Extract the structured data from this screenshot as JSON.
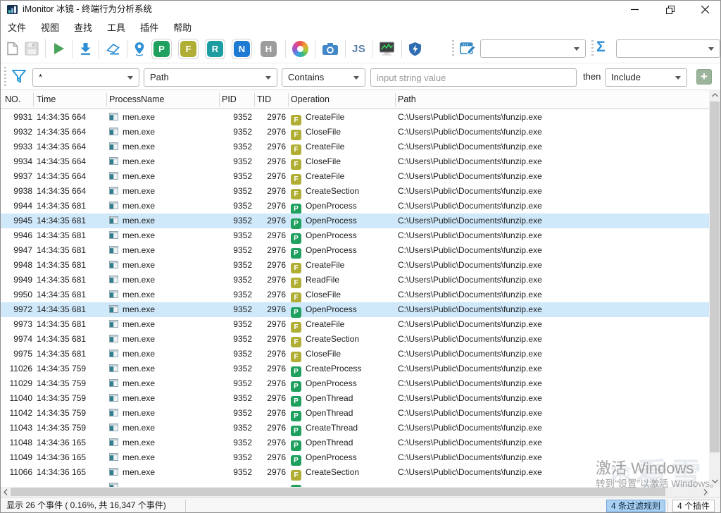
{
  "window": {
    "title": "iMonitor 冰镜 - 终端行为分析系统"
  },
  "menu": {
    "items": [
      "文件",
      "视图",
      "查找",
      "工具",
      "插件",
      "帮助"
    ]
  },
  "toolbar": {
    "letter_buttons": [
      {
        "label": "P",
        "color": "#1fa05e",
        "active": true
      },
      {
        "label": "F",
        "color": "#b0ae35",
        "active": true
      },
      {
        "label": "R",
        "color": "#1d9da2",
        "active": true
      },
      {
        "label": "N",
        "color": "#1d79d2",
        "active": true
      },
      {
        "label": "H",
        "color": "#9c9c9c",
        "active": false
      }
    ],
    "js_label": "JS",
    "sigma_label": "Σ",
    "combo1_value": "",
    "combo2_value": ""
  },
  "filter_bar": {
    "scope_value": "*",
    "field_value": "Path",
    "operator_value": "Contains",
    "input_value": "",
    "input_placeholder": "input string value",
    "then_label": "then",
    "action_value": "Include",
    "add_label": "+"
  },
  "table": {
    "columns": [
      "NO.",
      "Time",
      "ProcessName",
      "PID",
      "TID",
      "Operation",
      "Path"
    ],
    "rows": [
      {
        "no": "9931",
        "time": "14:34:35 664",
        "process": "men.exe",
        "pid": "9352",
        "tid": "2976",
        "op_icon": "F",
        "op": "CreateFile",
        "path": "C:\\Users\\Public\\Documents\\funzip.exe",
        "selected": false
      },
      {
        "no": "9932",
        "time": "14:34:35 664",
        "process": "men.exe",
        "pid": "9352",
        "tid": "2976",
        "op_icon": "F",
        "op": "CloseFile",
        "path": "C:\\Users\\Public\\Documents\\funzip.exe",
        "selected": false
      },
      {
        "no": "9933",
        "time": "14:34:35 664",
        "process": "men.exe",
        "pid": "9352",
        "tid": "2976",
        "op_icon": "F",
        "op": "CreateFile",
        "path": "C:\\Users\\Public\\Documents\\funzip.exe",
        "selected": false
      },
      {
        "no": "9934",
        "time": "14:34:35 664",
        "process": "men.exe",
        "pid": "9352",
        "tid": "2976",
        "op_icon": "F",
        "op": "CloseFile",
        "path": "C:\\Users\\Public\\Documents\\funzip.exe",
        "selected": false
      },
      {
        "no": "9937",
        "time": "14:34:35 664",
        "process": "men.exe",
        "pid": "9352",
        "tid": "2976",
        "op_icon": "F",
        "op": "CreateFile",
        "path": "C:\\Users\\Public\\Documents\\funzip.exe",
        "selected": false
      },
      {
        "no": "9938",
        "time": "14:34:35 664",
        "process": "men.exe",
        "pid": "9352",
        "tid": "2976",
        "op_icon": "F",
        "op": "CreateSection",
        "path": "C:\\Users\\Public\\Documents\\funzip.exe",
        "selected": false
      },
      {
        "no": "9944",
        "time": "14:34:35 681",
        "process": "men.exe",
        "pid": "9352",
        "tid": "2976",
        "op_icon": "P",
        "op": "OpenProcess",
        "path": "C:\\Users\\Public\\Documents\\funzip.exe",
        "selected": false
      },
      {
        "no": "9945",
        "time": "14:34:35 681",
        "process": "men.exe",
        "pid": "9352",
        "tid": "2976",
        "op_icon": "P",
        "op": "OpenProcess",
        "path": "C:\\Users\\Public\\Documents\\funzip.exe",
        "selected": true
      },
      {
        "no": "9946",
        "time": "14:34:35 681",
        "process": "men.exe",
        "pid": "9352",
        "tid": "2976",
        "op_icon": "P",
        "op": "OpenProcess",
        "path": "C:\\Users\\Public\\Documents\\funzip.exe",
        "selected": false
      },
      {
        "no": "9947",
        "time": "14:34:35 681",
        "process": "men.exe",
        "pid": "9352",
        "tid": "2976",
        "op_icon": "P",
        "op": "OpenProcess",
        "path": "C:\\Users\\Public\\Documents\\funzip.exe",
        "selected": false
      },
      {
        "no": "9948",
        "time": "14:34:35 681",
        "process": "men.exe",
        "pid": "9352",
        "tid": "2976",
        "op_icon": "F",
        "op": "CreateFile",
        "path": "C:\\Users\\Public\\Documents\\funzip.exe",
        "selected": false
      },
      {
        "no": "9949",
        "time": "14:34:35 681",
        "process": "men.exe",
        "pid": "9352",
        "tid": "2976",
        "op_icon": "F",
        "op": "ReadFile",
        "path": "C:\\Users\\Public\\Documents\\funzip.exe",
        "selected": false
      },
      {
        "no": "9950",
        "time": "14:34:35 681",
        "process": "men.exe",
        "pid": "9352",
        "tid": "2976",
        "op_icon": "F",
        "op": "CloseFile",
        "path": "C:\\Users\\Public\\Documents\\funzip.exe",
        "selected": false
      },
      {
        "no": "9972",
        "time": "14:34:35 681",
        "process": "men.exe",
        "pid": "9352",
        "tid": "2976",
        "op_icon": "P",
        "op": "OpenProcess",
        "path": "C:\\Users\\Public\\Documents\\funzip.exe",
        "selected": true
      },
      {
        "no": "9973",
        "time": "14:34:35 681",
        "process": "men.exe",
        "pid": "9352",
        "tid": "2976",
        "op_icon": "F",
        "op": "CreateFile",
        "path": "C:\\Users\\Public\\Documents\\funzip.exe",
        "selected": false
      },
      {
        "no": "9974",
        "time": "14:34:35 681",
        "process": "men.exe",
        "pid": "9352",
        "tid": "2976",
        "op_icon": "F",
        "op": "CreateSection",
        "path": "C:\\Users\\Public\\Documents\\funzip.exe",
        "selected": false
      },
      {
        "no": "9975",
        "time": "14:34:35 681",
        "process": "men.exe",
        "pid": "9352",
        "tid": "2976",
        "op_icon": "F",
        "op": "CloseFile",
        "path": "C:\\Users\\Public\\Documents\\funzip.exe",
        "selected": false
      },
      {
        "no": "11026",
        "time": "14:34:35 759",
        "process": "men.exe",
        "pid": "9352",
        "tid": "2976",
        "op_icon": "P",
        "op": "CreateProcess",
        "path": "C:\\Users\\Public\\Documents\\funzip.exe",
        "selected": false
      },
      {
        "no": "11029",
        "time": "14:34:35 759",
        "process": "men.exe",
        "pid": "9352",
        "tid": "2976",
        "op_icon": "P",
        "op": "OpenProcess",
        "path": "C:\\Users\\Public\\Documents\\funzip.exe",
        "selected": false
      },
      {
        "no": "11040",
        "time": "14:34:35 759",
        "process": "men.exe",
        "pid": "9352",
        "tid": "2976",
        "op_icon": "P",
        "op": "OpenThread",
        "path": "C:\\Users\\Public\\Documents\\funzip.exe",
        "selected": false
      },
      {
        "no": "11042",
        "time": "14:34:35 759",
        "process": "men.exe",
        "pid": "9352",
        "tid": "2976",
        "op_icon": "P",
        "op": "OpenThread",
        "path": "C:\\Users\\Public\\Documents\\funzip.exe",
        "selected": false
      },
      {
        "no": "11043",
        "time": "14:34:35 759",
        "process": "men.exe",
        "pid": "9352",
        "tid": "2976",
        "op_icon": "P",
        "op": "CreateThread",
        "path": "C:\\Users\\Public\\Documents\\funzip.exe",
        "selected": false
      },
      {
        "no": "11048",
        "time": "14:34:36 165",
        "process": "men.exe",
        "pid": "9352",
        "tid": "2976",
        "op_icon": "P",
        "op": "OpenThread",
        "path": "C:\\Users\\Public\\Documents\\funzip.exe",
        "selected": false
      },
      {
        "no": "11049",
        "time": "14:34:36 165",
        "process": "men.exe",
        "pid": "9352",
        "tid": "2976",
        "op_icon": "P",
        "op": "OpenProcess",
        "path": "C:\\Users\\Public\\Documents\\funzip.exe",
        "selected": false
      },
      {
        "no": "11066",
        "time": "14:34:36 165",
        "process": "men.exe",
        "pid": "9352",
        "tid": "2976",
        "op_icon": "F",
        "op": "CreateSection",
        "path": "C:\\Users\\Public\\Documents\\funzip.exe",
        "selected": false
      },
      {
        "no": "",
        "time": "",
        "process": "",
        "pid": "",
        "tid": "",
        "op_icon": "P",
        "op": "",
        "path": "",
        "selected": false,
        "partial": true
      }
    ]
  },
  "statusbar": {
    "left": "显示 26 个事件 ( 0.16%, 共 16,347 个事件)",
    "filter_badge": "4 条过滤规则",
    "plugin_badge": "4 个插件"
  },
  "watermark": {
    "line1": "激活 Windows",
    "line2": "转到“设置”以激活 Windows。",
    "logo": "❄看雪"
  },
  "colors": {
    "accent_blue": "#2e8fd6",
    "op_file": "#b0ae35",
    "op_process": "#1fa05e",
    "selection": "#cfe8fa",
    "filter_badge_bg": "#abd1f2"
  }
}
